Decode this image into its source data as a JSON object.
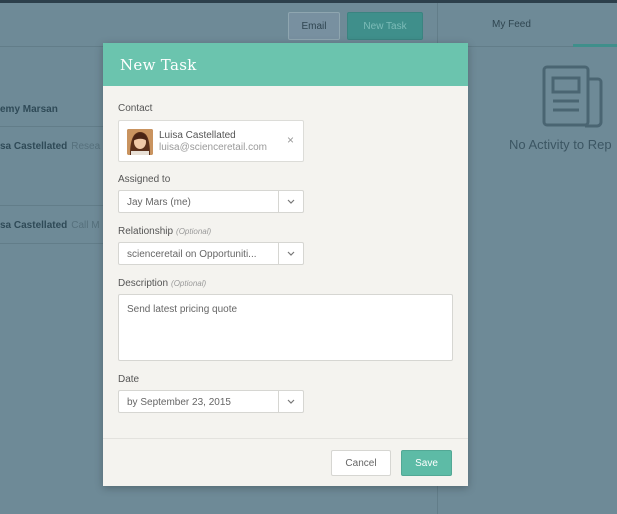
{
  "background": {
    "header": {
      "email_label": "Email",
      "new_task_label": "New Task"
    },
    "list": [
      {
        "name": "emy Marsan",
        "extra": ""
      },
      {
        "name": "sa Castellated",
        "extra": "Resea"
      },
      {
        "name": "sa Castellated",
        "extra": "Call M"
      }
    ],
    "feed": {
      "tab_label": "My Feed",
      "empty_text": "No Activity to Rep"
    }
  },
  "modal": {
    "title": "New Task",
    "contact": {
      "label": "Contact",
      "name": "Luisa Castellated",
      "email": "luisa@scienceretail.com",
      "remove_glyph": "×"
    },
    "assigned_to": {
      "label": "Assigned to",
      "value": "Jay Mars (me)"
    },
    "relationship": {
      "label": "Relationship",
      "optional": "(Optional)",
      "value": "scienceretail on Opportuniti..."
    },
    "description": {
      "label": "Description",
      "optional": "(Optional)",
      "value": "Send latest pricing quote"
    },
    "date": {
      "label": "Date",
      "value": "by September 23, 2015"
    },
    "footer": {
      "cancel_label": "Cancel",
      "save_label": "Save"
    }
  },
  "colors": {
    "accent": "#6bc4ae",
    "save_button": "#5dbba6",
    "overlay_background": "#6e8a97"
  },
  "icons": [
    "chevron-down-icon",
    "close-icon",
    "newspaper-icon",
    "avatar"
  ]
}
